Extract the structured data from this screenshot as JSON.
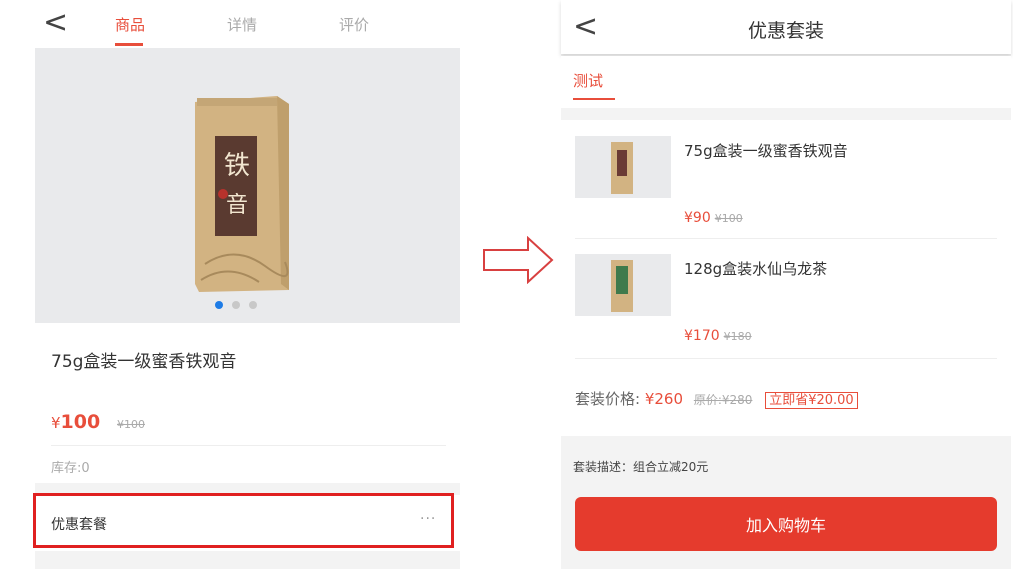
{
  "left": {
    "back_glyph": "<",
    "tabs": [
      {
        "label": "商品",
        "active": true
      },
      {
        "label": "详情",
        "active": false
      },
      {
        "label": "评价",
        "active": false
      }
    ],
    "carousel": {
      "count": 3,
      "active_index": 0,
      "box_text": "铁音"
    },
    "product": {
      "name": "75g盒装一级蜜香铁观音",
      "currency": "¥",
      "price": "100",
      "old_price": "¥100",
      "stock": "库存:0"
    },
    "combo": {
      "label": "优惠套餐",
      "more": "···"
    }
  },
  "arrow_icon": "right-arrow-icon",
  "right": {
    "back_glyph": "<",
    "title": "优惠套装",
    "tab": "测试",
    "items": [
      {
        "title": "75g盒装一级蜜香铁观音",
        "price": "¥90",
        "old_price": "¥100",
        "label_color": "#6a3b35"
      },
      {
        "title": "128g盒装水仙乌龙茶",
        "price": "¥170",
        "old_price": "¥180",
        "label_color": "#3f7a4c"
      }
    ],
    "total": {
      "label": "套装价格:",
      "price": "¥260",
      "original": "原价:¥280",
      "save": "立即省¥20.00"
    },
    "description": "套装描述：组合立减20元",
    "add_to_cart": "加入购物车"
  },
  "colors": {
    "accent": "#e84e3b",
    "highlight": "#e02020",
    "carousel_active": "#1e7ce6"
  }
}
